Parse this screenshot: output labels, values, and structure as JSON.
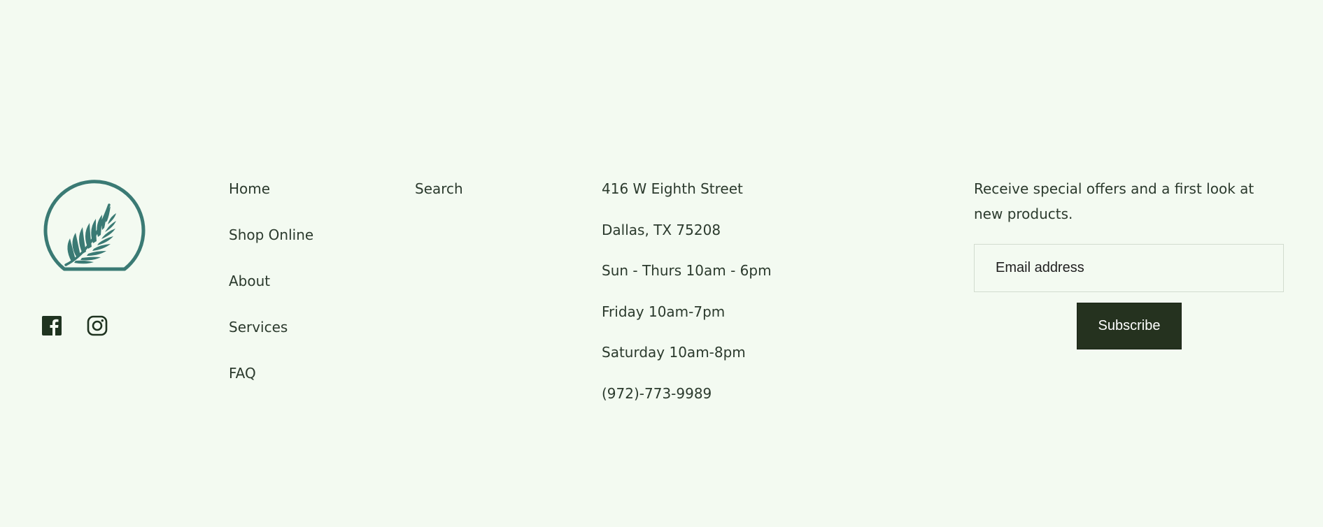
{
  "footer": {
    "logo_icon": "fern-in-circle-logo",
    "brand_color": "#3a7a74",
    "social": {
      "facebook_icon": "facebook-icon",
      "instagram_icon": "instagram-icon"
    },
    "nav_primary": [
      {
        "label": "Home"
      },
      {
        "label": "Shop Online"
      },
      {
        "label": "About"
      },
      {
        "label": "Services"
      },
      {
        "label": "FAQ"
      }
    ],
    "nav_secondary": [
      {
        "label": "Search"
      }
    ],
    "contact": {
      "address_line1": "416 W Eighth Street",
      "address_line2": "Dallas, TX 75208",
      "hours_sun_thu": "Sun - Thurs 10am - 6pm",
      "hours_fri": "Friday 10am-7pm",
      "hours_sat": "Saturday 10am-8pm",
      "phone": "(972)-773-9989"
    },
    "newsletter": {
      "text": "Receive special offers and a first look at new products.",
      "email_placeholder": "Email address",
      "email_value": "",
      "subscribe_label": "Subscribe"
    },
    "colors": {
      "background": "#f3faf1",
      "button_bg": "#25321f",
      "text": "#2b3a2d"
    }
  }
}
